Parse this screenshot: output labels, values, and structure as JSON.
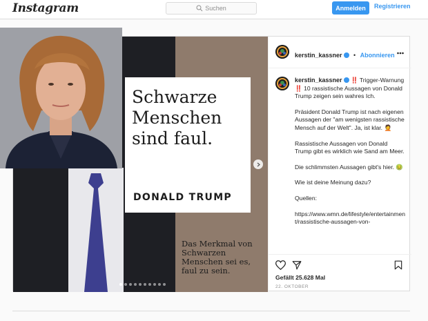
{
  "nav": {
    "logo": "Instagram",
    "search_placeholder": "Suchen",
    "login_label": "Anmelden",
    "register_label": "Registrieren"
  },
  "post": {
    "image": {
      "card_title": "Schwarze Menschen sind faul.",
      "card_author": "DONALD TRUMP",
      "quote_caption": "Das Merkmal von Schwarzen Menschen sei es, faul zu sein.",
      "slide_count": 10,
      "active_slide": 1
    },
    "header": {
      "username": "kerstin_kassner",
      "separator": "•",
      "follow_label": "Abonnieren",
      "more_icon": "more-horizontal-icon"
    },
    "caption": {
      "username": "kerstin_kassner",
      "line1": "‼️ Trigger-Warnung ‼️ 10 rassistische Aussagen von Donald Trump zeigen sein wahres Ich.",
      "para2": "Präsident Donald Trump ist nach eigenen Aussagen der \"am wenigsten rassistische Mensch auf der Welt\". Ja, ist klar. 🤦",
      "para3": "Rassistische Aussagen von Donald Trump gibt es wirklich wie Sand am Meer.",
      "para4": "Die schlimmsten Aussagen gibt's hier. 🤢",
      "para5": "Wie ist deine Meinung dazu?",
      "para6": "Quellen:",
      "para7": "https://www.wmn.de/lifestyle/entertainment/rassistische-aussagen-von-"
    },
    "likes": "Gefällt 25.628 Mal",
    "date": "22. OKTOBER"
  },
  "colors": {
    "accent": "#3897f0",
    "text": "#262626",
    "muted": "#8e8e8e",
    "border": "#dbdbdb"
  }
}
